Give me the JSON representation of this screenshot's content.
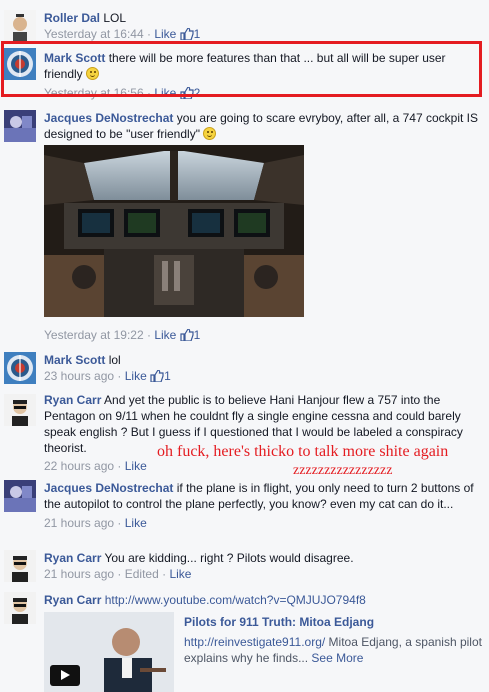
{
  "comments": [
    {
      "name": "Roller Dal",
      "text": "LOL",
      "time": "Yesterday at 16:44",
      "like": "Like",
      "likes": "1"
    },
    {
      "name": "Mark Scott",
      "text": "there will be more features than that ... but all will be super user friendly",
      "time": "Yesterday at 16:56",
      "like": "Like",
      "likes": "2"
    },
    {
      "name": "Jacques DeNostrechat",
      "text": "you are going to scare evryboy, after all, a 747 cockpit IS designed to be \"user friendly\"",
      "time": "Yesterday at 19:22",
      "like": "Like",
      "likes": "1"
    },
    {
      "name": "Mark Scott",
      "text": "lol",
      "time": "23 hours ago",
      "like": "Like",
      "likes": "1"
    },
    {
      "name": "Ryan Carr",
      "text": "And yet the public is to believe Hani Hanjour flew a 757 into the Pentagon on 9/11 when he couldnt fly a single engine cessna and could barely speak english ? But I guess if I questioned that I would be labeled a conspiracy theorist.",
      "time": "22 hours ago",
      "like": "Like"
    },
    {
      "name": "Jacques DeNostrechat",
      "text": "if the plane is in flight, you only need to turn 2 buttons of the autopilot to control the plane perfectly, you know? even my cat can do it...",
      "time": "21 hours ago",
      "like": "Like"
    },
    {
      "name": "Ryan Carr",
      "text": "You are kidding... right ? Pilots would disagree.",
      "time": "21 hours ago",
      "edited": "Edited",
      "like": "Like"
    },
    {
      "name": "Ryan Carr",
      "link": "http://www.youtube.com/watch?v=QMJUJO794f8"
    }
  ],
  "separator": " · ",
  "preview": {
    "title": "Pilots for 911 Truth: Mitoa Edjang",
    "url": "http://reinvestigate911.org/",
    "description": "Mitoa Edjang, a spanish pilot explains why he finds...",
    "see_more": "See More"
  },
  "annotations": {
    "line1": "oh fuck, here's thicko to talk more shite again",
    "line2": "zzzzzzzzzzzzzzzz"
  },
  "colors": {
    "link": "#3b5998",
    "meta": "#9197a3",
    "highlight": "#e41c21"
  }
}
